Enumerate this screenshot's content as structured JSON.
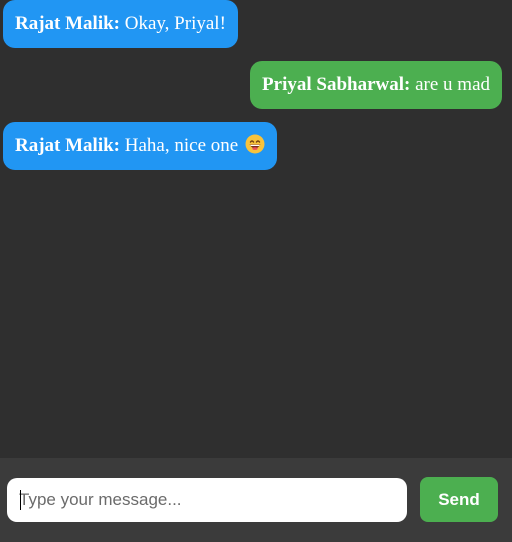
{
  "messages": [
    {
      "sender": "Rajat Malik:",
      "text": "Okay, Priyal!",
      "direction": "incoming"
    },
    {
      "sender": "Priyal Sabharwal:",
      "text": "are u mad",
      "direction": "outgoing"
    },
    {
      "sender": "Rajat Malik:",
      "text": "Haha, nice one",
      "direction": "incoming",
      "emoji": "grinning-face-icon"
    }
  ],
  "composer": {
    "placeholder": "Type your message...",
    "value": "",
    "send_label": "Send"
  },
  "colors": {
    "background": "#2f2f2f",
    "input_bar": "#3b3b3b",
    "incoming_bubble": "#2196f3",
    "outgoing_bubble": "#4caf50",
    "send_button": "#4caf50"
  }
}
